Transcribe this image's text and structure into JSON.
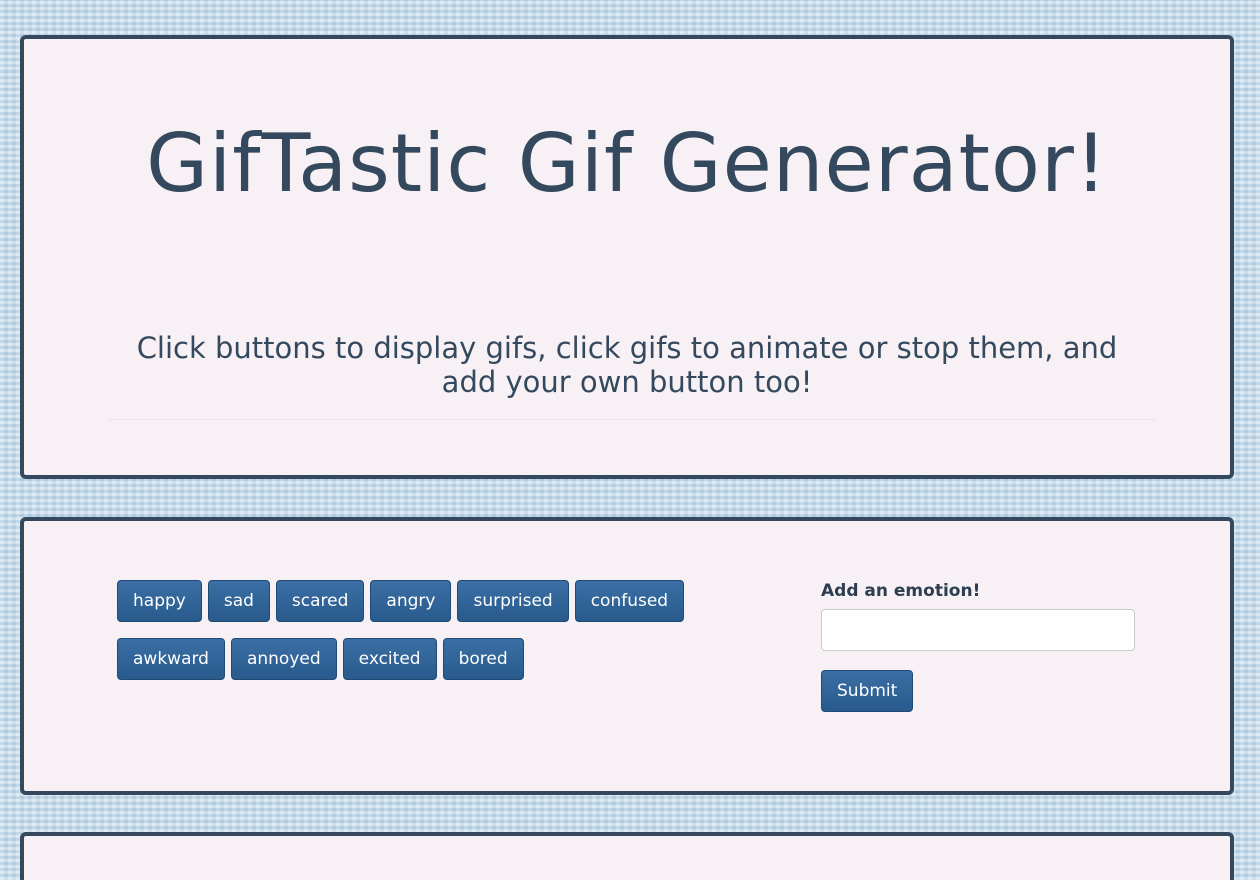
{
  "header": {
    "title": "GifTastic Gif Generator!",
    "subtitle": "Click buttons to display gifs, click gifs to animate or stop them, and add your own button too!"
  },
  "emotion_buttons": [
    {
      "label": "happy"
    },
    {
      "label": "sad"
    },
    {
      "label": "scared"
    },
    {
      "label": "angry"
    },
    {
      "label": "surprised"
    },
    {
      "label": "confused"
    },
    {
      "label": "awkward"
    },
    {
      "label": "annoyed"
    },
    {
      "label": "excited"
    },
    {
      "label": "bored"
    }
  ],
  "form": {
    "label": "Add an emotion!",
    "input_value": "",
    "submit_label": "Submit"
  },
  "colors": {
    "panel_background": "#f7f0f4",
    "panel_border": "#34495e",
    "button_primary": "#2d6196",
    "text": "#34495e"
  }
}
